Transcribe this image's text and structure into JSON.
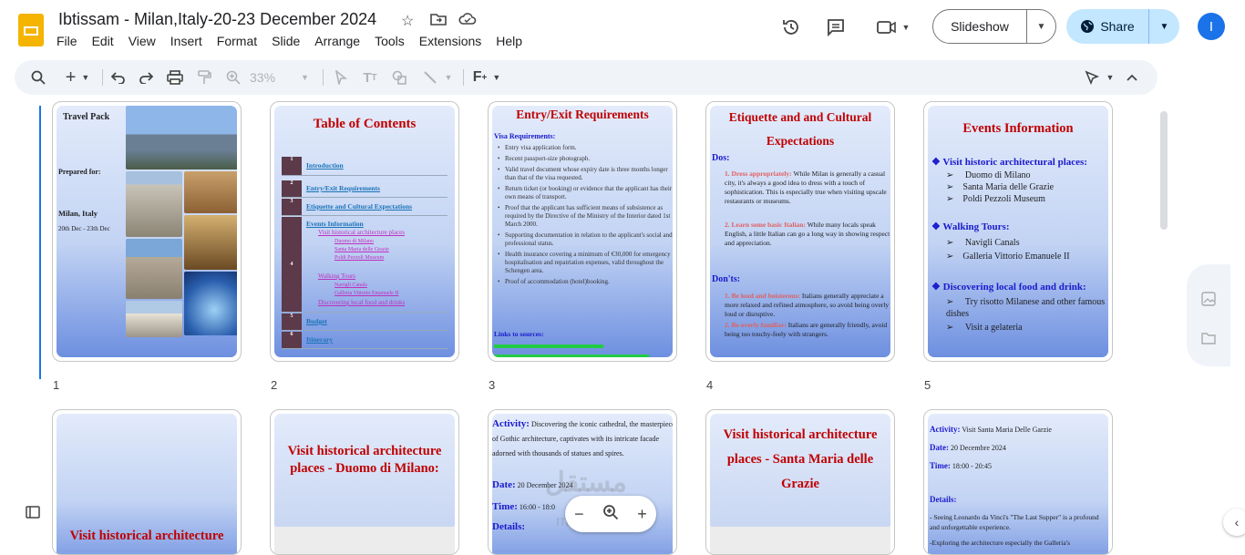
{
  "app": {
    "title": "Ibtissam - Milan,Italy-20-23 December 2024",
    "logo_icon": "slides-logo-icon"
  },
  "menu": [
    "File",
    "Edit",
    "View",
    "Insert",
    "Format",
    "Slide",
    "Arrange",
    "Tools",
    "Extensions",
    "Help"
  ],
  "header": {
    "slideshow_label": "Slideshow",
    "share_label": "Share",
    "avatar_letter": "I"
  },
  "toolbar": {
    "zoom": "33%"
  },
  "slides": {
    "s1": {
      "number": "1",
      "title": "Travel Pack",
      "prepared": "Prepared for:",
      "place": "Milan, Italy",
      "dates": "20th Dec - 23th Dec"
    },
    "s2": {
      "number": "2",
      "title": "Table of Contents",
      "rows": [
        {
          "n": "1",
          "label": "Introduction"
        },
        {
          "n": "2",
          "label": "Entry/Exit Requirements"
        },
        {
          "n": "3",
          "label": "Etiquette and Cultural Expectations"
        },
        {
          "n": "4",
          "label": "Events Information",
          "subs": [
            "Visit historical architecture places",
            "Duomo di Milano",
            "Santa Maria delle Grazie",
            "Poldi Pezzoli Museum",
            "Walking Tours",
            "Navigli Canals",
            "Galleria Vittorio Emanuele II",
            "Discovering local food and drinks"
          ]
        },
        {
          "n": "5",
          "label": "Budget"
        },
        {
          "n": "6",
          "label": "Itinerary"
        }
      ]
    },
    "s3": {
      "number": "3",
      "title": "Entry/Exit Requirements",
      "visa_heading": "Visa Requirements:",
      "items": [
        "Entry visa application form.",
        "Recent passport-size photograph.",
        "Valid travel document whose expiry date is three months longer than that of the visa requested.",
        "Return ticket (or booking) or evidence that the applicant has their own means of transport.",
        "Proof that the applicant has sufficient means of subsistence as required by the Directive of the Ministry of the Interior dated 1st March 2000.",
        "Supporting documentation in relation to the applicant's social and professional status.",
        "Health insurance covering a minimum of €30,000 for emergency hospitalisation and repatriation expenses, valid throughout the Schengen area.",
        "Proof of accommodation (hotel)booking."
      ],
      "links_heading": "Links to sources:"
    },
    "s4": {
      "number": "4",
      "title": "Etiquette and and Cultural Expectations",
      "dos": "Dos:",
      "do1_lead": "Dress appropriately:",
      "do1_text": "While Milan is generally a casual city, it's always a good idea to dress with a touch of sophistication. This is especially true when visiting upscale restaurants or museums.",
      "do2_lead": "Learn some basic Italian:",
      "do2_text": "While many locals speak English, a little Italian can go a long way in showing respect and appreciation.",
      "donts": "Don'ts:",
      "dont1_lead": "Be loud and boisterous:",
      "dont1_text": "Italians generally appreciate a more relaxed and refined atmosphere, so avoid being overly loud or disruptive.",
      "dont2_lead": "Be overly familiar:",
      "dont2_text": "Italians are generally friendly, avoid being too touchy-feely with strangers."
    },
    "s5": {
      "number": "5",
      "title": "Events Information",
      "h1": "Visit historic architectural places:",
      "h1_items": [
        "Duomo di Milano",
        "Santa Maria delle Grazie",
        "Poldi Pezzoli Museum"
      ],
      "h2": "Walking Tours:",
      "h2_items": [
        "Navigli Canals",
        "Galleria Vittorio Emanuele II"
      ],
      "h3": "Discovering local food and drink:",
      "h3_items": [
        "Try risotto Milanese and other famous dishes",
        "Visit a gelateria"
      ]
    },
    "s6": {
      "title": "Visit historical architecture"
    },
    "s7": {
      "title": "Visit historical architecture places - Duomo di Milano:"
    },
    "s8": {
      "activity_label": "Activity:",
      "activity_text": "Discovering the  iconic cathedral, the masterpiece of Gothic architecture, captivates with its intricate facade adorned with thousands of statues and spires.",
      "date_label": "Date:",
      "date_text": "20 December 2024",
      "time_label": "Time:",
      "time_text": "16:00 - 18:0",
      "details_label": "Details:"
    },
    "s9": {
      "title": "Visit historical architecture places - Santa Maria delle Grazie"
    },
    "s10": {
      "activity_label": "Activity:",
      "activity_text": "Visit Santa Maria Delle Garzie",
      "date_label": "Date:",
      "date_text": "20 Decembre 2024",
      "time_label": "Time:",
      "time_text": "18:00 - 20:45",
      "details_label": "Details:",
      "d1": "- Seeing Leonardo da Vinci's \"The Last Supper\" is a profound and unforgettable experience.",
      "d2": "-Exploring the architecture especially the Galleria's"
    }
  },
  "watermark": "mostaql.com"
}
